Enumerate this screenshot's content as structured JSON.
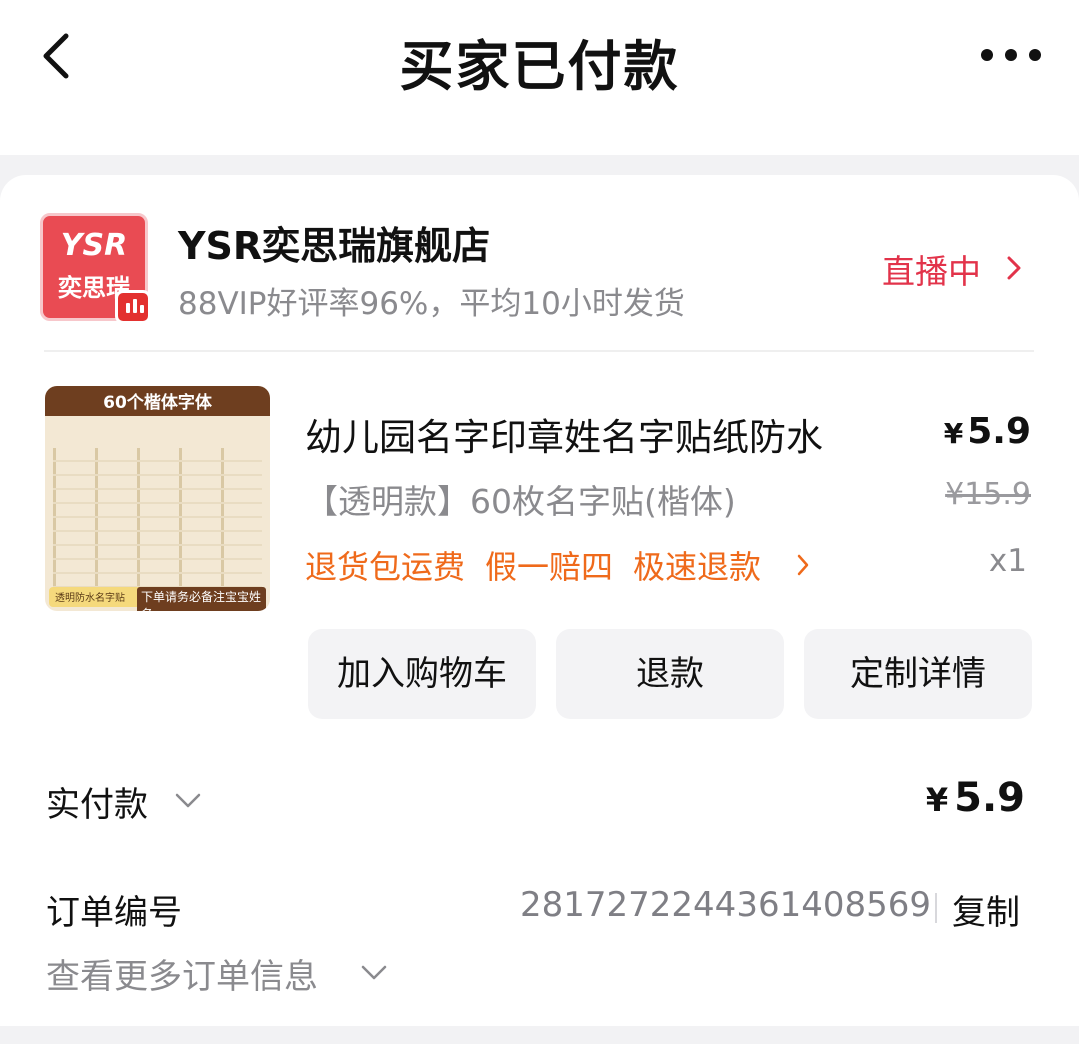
{
  "header": {
    "title": "买家已付款",
    "back_icon": "chevron-left-icon",
    "more_icon": "more-dots-icon"
  },
  "shop": {
    "logo_text_top": "YSR",
    "logo_text_bottom": "奕思瑞",
    "name": "YSR奕思瑞旗舰店",
    "subtitle": "88VIP好评率96%，平均10小时发货",
    "live_label": "直播中"
  },
  "product": {
    "image_banner": "60个楷体字体",
    "image_footer_left": "透明防水名字贴",
    "image_footer_right": "下单请务必备注宝宝姓名",
    "title": "幼儿园名字印章姓名字贴纸防水",
    "currency": "¥",
    "price": "5.9",
    "sku": "【透明款】60枚名字贴(楷体)",
    "original_price": "¥15.9",
    "tags": [
      "退货包运费",
      "假一赔四",
      "极速退款"
    ],
    "quantity": "x1"
  },
  "actions": {
    "add_to_cart": "加入购物车",
    "refund": "退款",
    "custom_details": "定制详情"
  },
  "payment": {
    "label": "实付款",
    "currency": "¥",
    "amount": "5.9"
  },
  "order": {
    "label": "订单编号",
    "number": "2817272244361408569",
    "copy_label": "复制",
    "more_info": "查看更多订单信息"
  },
  "colors": {
    "live_red": "#e2334a",
    "tag_orange": "#ef6a1b",
    "logo_red": "#e94b53"
  }
}
